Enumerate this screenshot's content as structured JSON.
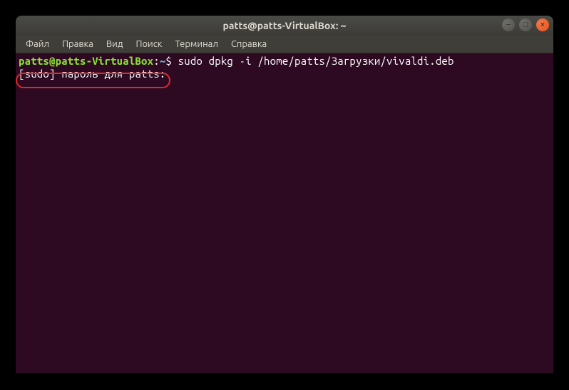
{
  "window": {
    "title": "patts@patts-VirtualBox: ~"
  },
  "menubar": {
    "items": [
      {
        "label": "Файл"
      },
      {
        "label": "Правка"
      },
      {
        "label": "Вид"
      },
      {
        "label": "Поиск"
      },
      {
        "label": "Терминал"
      },
      {
        "label": "Справка"
      }
    ]
  },
  "terminal": {
    "prompt": {
      "userhost": "patts@patts-VirtualBox",
      "colon": ":",
      "path": "~",
      "dollar": "$"
    },
    "command": " sudo dpkg -i /home/patts/Загрузки/vivaldi.deb",
    "line2": "[sudo] пароль для patts: "
  },
  "window_controls": {
    "min": "−",
    "max": "□",
    "close": "×"
  }
}
